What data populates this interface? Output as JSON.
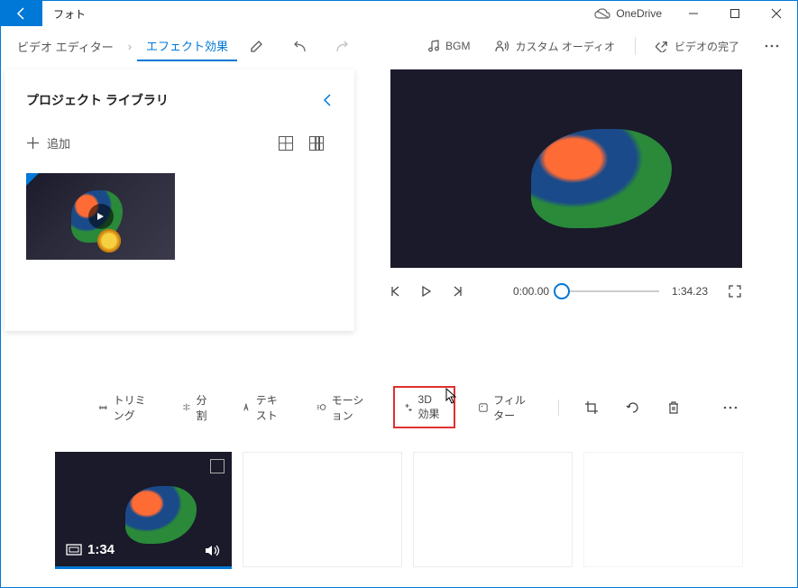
{
  "window": {
    "title": "フォト",
    "onedrive": "OneDrive"
  },
  "breadcrumb": {
    "level1": "ビデオ エディター",
    "level2": "エフェクト効果"
  },
  "toolbar": {
    "bgm": "BGM",
    "custom_audio": "カスタム オーディオ",
    "finish": "ビデオの完了"
  },
  "library": {
    "title": "プロジェクト ライブラリ",
    "add": "追加"
  },
  "player": {
    "current": "0:00.00",
    "total": "1:34.23"
  },
  "clip_tools": {
    "trim": "トリミング",
    "split": "分割",
    "text": "テキスト",
    "motion": "モーション",
    "effects3d": "3D 効果",
    "filter": "フィルター"
  },
  "timeline": {
    "clip1_duration": "1:34"
  }
}
